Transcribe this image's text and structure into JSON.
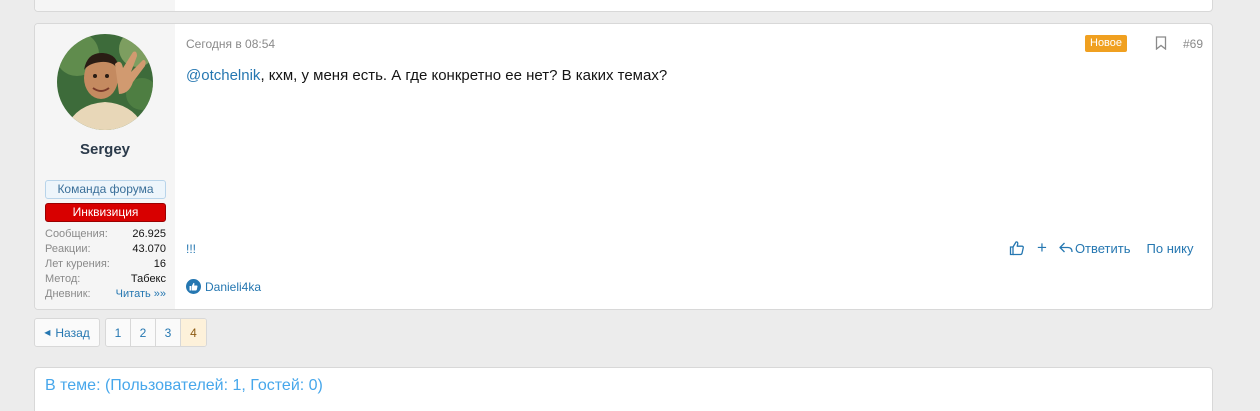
{
  "post": {
    "author": {
      "name": "Sergey",
      "banners": [
        "Команда форума",
        "Инквизиция"
      ],
      "stats": [
        {
          "label": "Сообщения:",
          "value": "26.925"
        },
        {
          "label": "Реакции:",
          "value": "43.070"
        },
        {
          "label": "Лет курения:",
          "value": "16"
        },
        {
          "label": "Метод:",
          "value": "Табекс"
        },
        {
          "label": "Дневник:",
          "value": "Читать »»"
        }
      ]
    },
    "date": "Сегодня в 08:54",
    "new_label": "Новое",
    "number": "#69",
    "mention": "@otchelnik",
    "body": ", кхм, у меня есть. А где конкретно ее нет? В каких темах?",
    "signature": "!!!",
    "actions": {
      "reply": "Ответить",
      "by_nick": "По нику"
    },
    "reactions": {
      "user": "Danieli4ka"
    }
  },
  "pagination": {
    "back_label": "Назад",
    "pages": [
      "1",
      "2",
      "3",
      "4"
    ],
    "current": "4"
  },
  "online": {
    "title": "В теме: (Пользователей: 1, Гостей: 0)"
  },
  "colors": {
    "link": "#2577b1",
    "new_badge": "#f0a020",
    "inquisition": "#d80000",
    "online_title": "#47a7eb"
  }
}
